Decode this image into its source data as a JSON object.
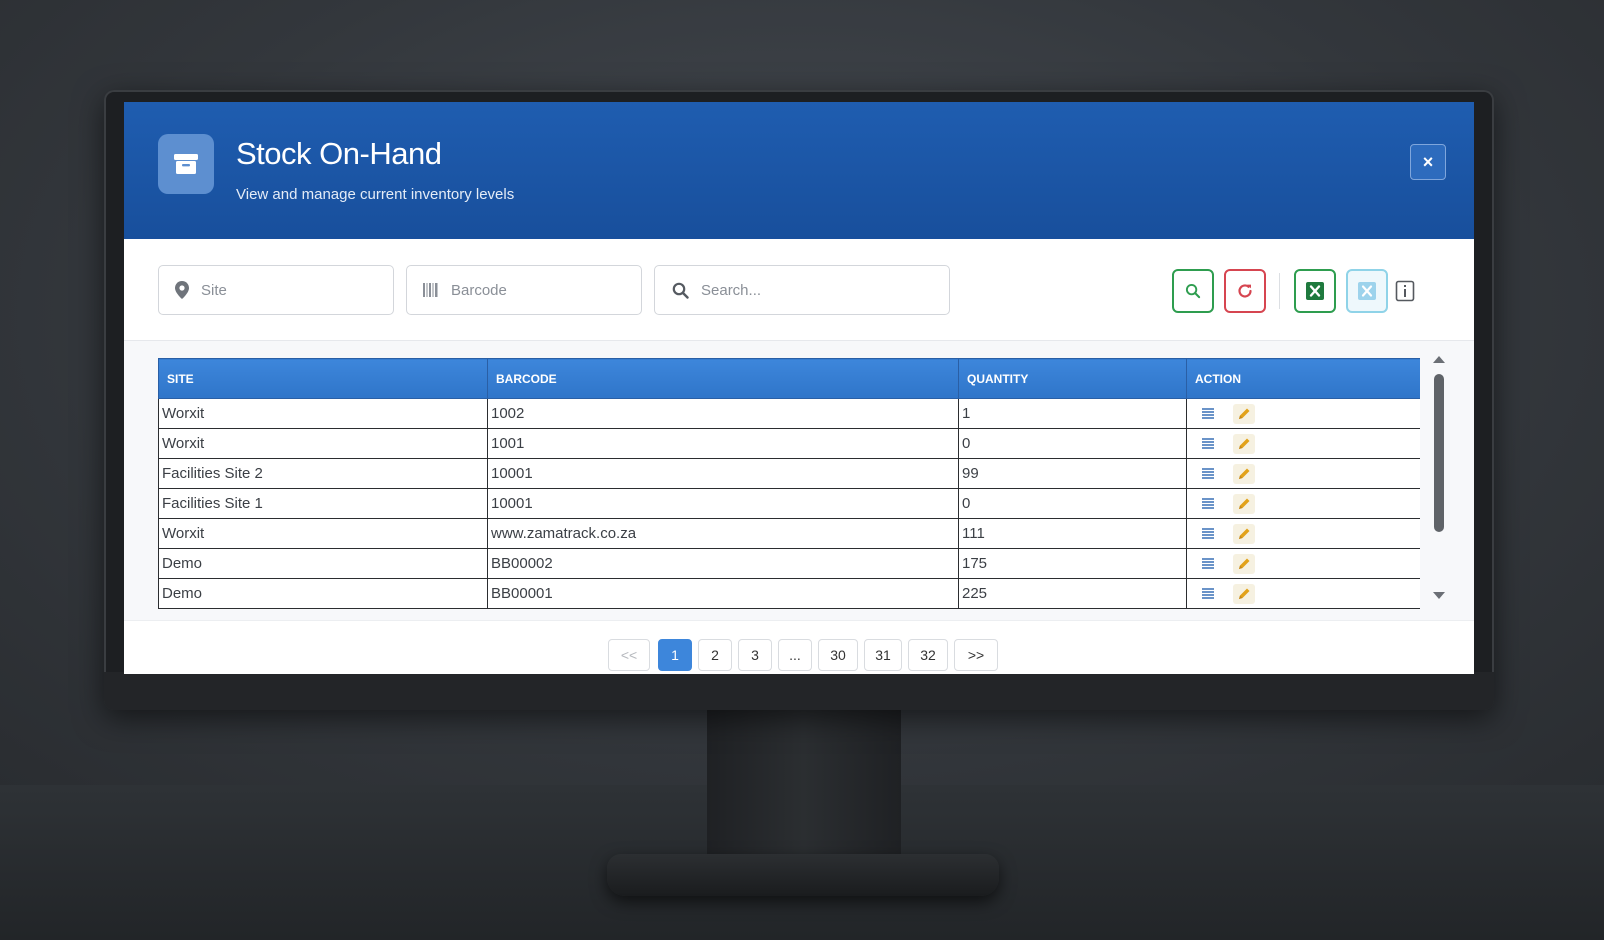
{
  "header": {
    "title": "Stock On-Hand",
    "subtitle": "View and manage current inventory levels",
    "icon": "archive-box-icon",
    "close_label": "×"
  },
  "filters": {
    "site_placeholder": "Site",
    "barcode_placeholder": "Barcode",
    "search_placeholder": "Search..."
  },
  "toolbar": {
    "buttons": [
      "search-icon",
      "refresh-icon",
      "excel-export-icon",
      "excel-import-icon",
      "info-icon"
    ]
  },
  "table": {
    "columns": [
      "SITE",
      "BARCODE",
      "QUANTITY",
      "ACTION"
    ],
    "rows": [
      {
        "site": "Worxit",
        "barcode": "1002",
        "quantity": "1"
      },
      {
        "site": "Worxit",
        "barcode": "1001",
        "quantity": "0"
      },
      {
        "site": "Facilities Site 2",
        "barcode": "10001",
        "quantity": "99"
      },
      {
        "site": "Facilities Site 1",
        "barcode": "10001",
        "quantity": "0"
      },
      {
        "site": "Worxit",
        "barcode": "www.zamatrack.co.za",
        "quantity": "111"
      },
      {
        "site": "Demo",
        "barcode": "BB00002",
        "quantity": "175"
      },
      {
        "site": "Demo",
        "barcode": "BB00001",
        "quantity": "225"
      }
    ]
  },
  "pagination": {
    "prev": "<<",
    "pages": [
      "1",
      "2",
      "3",
      "...",
      "30",
      "31",
      "32"
    ],
    "next": ">>",
    "current": "1"
  },
  "colors": {
    "header_blue": "#1f5db0",
    "table_header_blue": "#3d86db",
    "search_green": "#2e9d4f",
    "refresh_red": "#d64550",
    "excel_green": "#1f7a3e",
    "edit_yellow": "#e2a21a"
  }
}
